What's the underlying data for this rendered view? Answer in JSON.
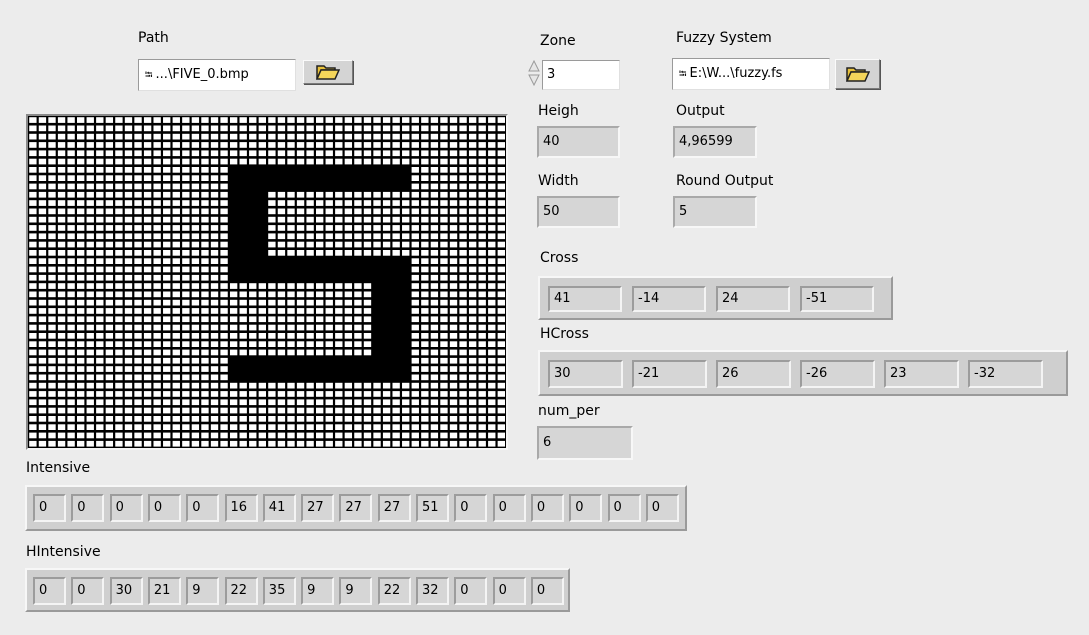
{
  "path": {
    "label": "Path",
    "value": "...\\FIVE_0.bmp",
    "browse_icon": "folder-open-icon"
  },
  "zone": {
    "label": "Zone",
    "value": "3"
  },
  "fuzzy": {
    "label": "Fuzzy System",
    "value": "E:\\W...\\fuzzy.fs",
    "browse_icon": "folder-open-icon"
  },
  "heigh": {
    "label": "Heigh",
    "value": "40"
  },
  "output": {
    "label": "Output",
    "value": "4,96599"
  },
  "width": {
    "label": "Width",
    "value": "50"
  },
  "round_output": {
    "label": "Round Output",
    "value": "5"
  },
  "cross": {
    "label": "Cross",
    "values": [
      "41",
      "-14",
      "24",
      "-51"
    ]
  },
  "hcross": {
    "label": "HCross",
    "values": [
      "30",
      "-21",
      "26",
      "-26",
      "23",
      "-32"
    ]
  },
  "num_per": {
    "label": "num_per",
    "value": "6"
  },
  "intensive": {
    "label": "Intensive",
    "values": [
      "0",
      "0",
      "0",
      "0",
      "0",
      "16",
      "41",
      "27",
      "27",
      "27",
      "51",
      "0",
      "0",
      "0",
      "0",
      "0",
      "0"
    ]
  },
  "hintensive": {
    "label": "HIntensive",
    "values": [
      "0",
      "0",
      "30",
      "21",
      "9",
      "22",
      "35",
      "9",
      "9",
      "22",
      "32",
      "0",
      "0",
      "0"
    ]
  },
  "image": {
    "cols": 50,
    "rows": 40,
    "digit_segments": [
      {
        "c0": 21,
        "c1": 39,
        "r0": 6,
        "r1": 8
      },
      {
        "c0": 21,
        "c1": 24,
        "r0": 6,
        "r1": 19
      },
      {
        "c0": 21,
        "c1": 39,
        "r0": 17,
        "r1": 19
      },
      {
        "c0": 36,
        "c1": 39,
        "r0": 17,
        "r1": 31
      },
      {
        "c0": 21,
        "c1": 39,
        "r0": 29,
        "r1": 31
      }
    ]
  },
  "colors": {
    "background": "#ececec",
    "indicator": "#d6d6d6",
    "pixel_on": "#000000",
    "pixel_off": "#ffffff"
  }
}
